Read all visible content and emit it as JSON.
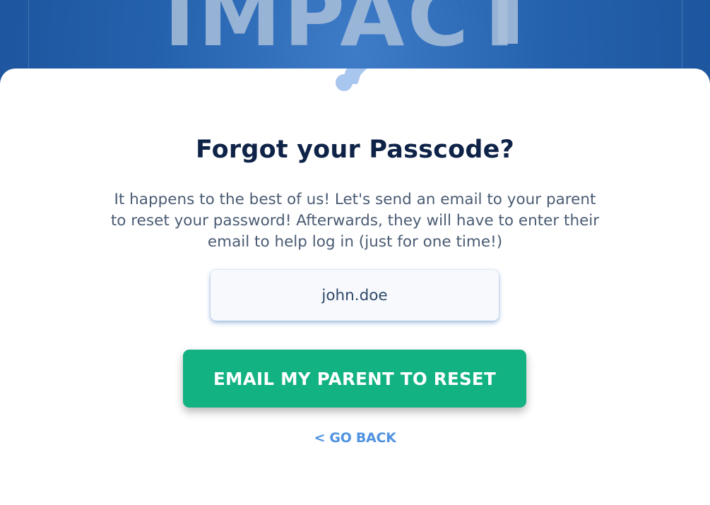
{
  "brand": {
    "logo_text": "IMPACT"
  },
  "colors": {
    "background": "#2461ad",
    "card": "#ffffff",
    "title": "#0e2347",
    "primary_button": "#12b283",
    "link": "#4f92e0",
    "question_mark": "#a9c6ef"
  },
  "header": {
    "icon": "question-mark-cloud-icon"
  },
  "form": {
    "title": "Forgot your Passcode?",
    "description": "It happens to the best of us! Let's send an email to your parent to reset your password! Afterwards, they will have to enter their email to help log in (just for one time!)",
    "username_value": "john.doe",
    "submit_label": "EMAIL MY PARENT TO RESET",
    "back_label": "< GO BACK"
  }
}
